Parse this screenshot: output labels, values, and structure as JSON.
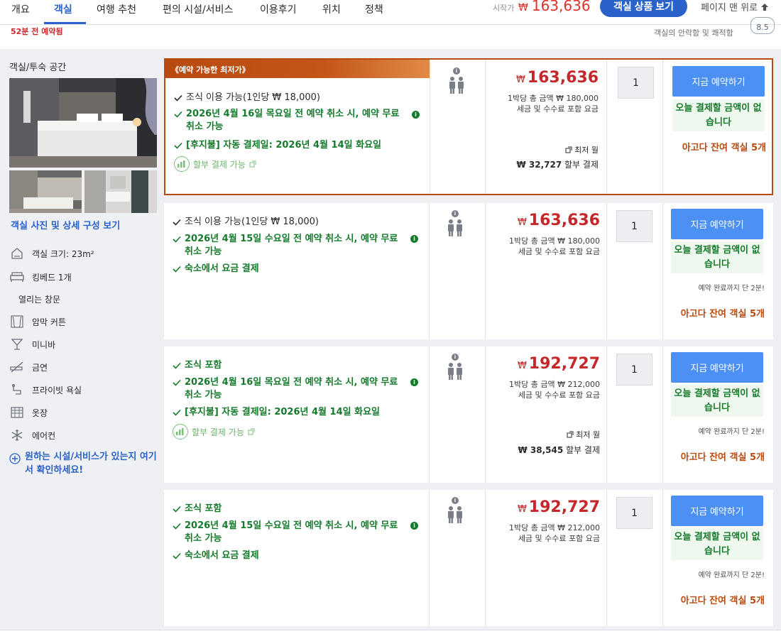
{
  "nav": {
    "tabs": [
      "개요",
      "객실",
      "여행 추천",
      "편의 시설/서비스",
      "이용후기",
      "위치",
      "정책"
    ],
    "start_label": "시작가",
    "currency": "₩",
    "start_price": "163,636",
    "view_rooms_button": "객실 상품 보기",
    "back_to_top": "페이지 맨 위로"
  },
  "substrip": {
    "booked_ago": "52분 전 예약됨",
    "comfort_label": "객실의 안락함 및 쾌적함",
    "score": "8.5"
  },
  "room": {
    "title": "객실/투숙 공간",
    "view_photos": "객실 사진 및 상세 구성 보기",
    "features": [
      {
        "icon": "room-size-icon",
        "label": "객실 크기: 23m²"
      },
      {
        "icon": "bed-icon",
        "label": "킹베드 1개"
      },
      {
        "icon": "",
        "label": "열리는 창문"
      },
      {
        "icon": "curtain-icon",
        "label": "암막 커튼"
      },
      {
        "icon": "minibar-icon",
        "label": "미니바"
      },
      {
        "icon": "no-smoking-icon",
        "label": "금연"
      },
      {
        "icon": "bathroom-icon",
        "label": "프라이빗 욕실"
      },
      {
        "icon": "wardrobe-icon",
        "label": "옷장"
      },
      {
        "icon": "snowflake-icon",
        "label": "에어컨"
      }
    ],
    "facility_link": "원하는 시설/서비스가 있는지 여기서 확인하세요!"
  },
  "offers": [
    {
      "ribbon": "《예약 가능한 최저가》",
      "benefits": [
        {
          "text": "조식 이용 가능(1인당 ₩ 18,000)",
          "style": "plain"
        },
        {
          "text": "2026년 4월 16일 목요일 전 예약 취소 시, 예약 무료 취소 가능",
          "style": "green",
          "info": true
        },
        {
          "text": "[후지불] 자동 결제일: 2026년 4월 14일 화요일",
          "style": "green"
        }
      ],
      "installment": "할부 결제 가능",
      "price": "163,636",
      "price_total": "1박당 총 금액 ₩ 180,000",
      "price_note": "세금 및 수수료 포함 요금",
      "monthly_label": "최저 월",
      "monthly_amount": "₩ 32,727",
      "monthly_suffix": "할부 결제",
      "qty": "1",
      "book_button": "지금 예약하기",
      "pay_today": "오늘 결제할 금액이 없습니다",
      "hurry": "",
      "rooms_left": "아고다 잔여 객실 5개"
    },
    {
      "ribbon": "",
      "benefits": [
        {
          "text": "조식 이용 가능(1인당 ₩ 18,000)",
          "style": "plain"
        },
        {
          "text": "2026년 4월 15일 수요일 전 예약 취소 시, 예약 무료 취소 가능",
          "style": "green",
          "info": true
        },
        {
          "text": "숙소에서 요금 결제",
          "style": "green"
        }
      ],
      "installment": "",
      "price": "163,636",
      "price_total": "1박당 총 금액 ₩ 180,000",
      "price_note": "세금 및 수수료 포함 요금",
      "monthly_label": "",
      "monthly_amount": "",
      "monthly_suffix": "",
      "qty": "1",
      "book_button": "지금 예약하기",
      "pay_today": "오늘 결제할 금액이 없습니다",
      "hurry": "예약 완료까지 단 2분!",
      "rooms_left": "아고다 잔여 객실 5개"
    },
    {
      "ribbon": "",
      "benefits": [
        {
          "text": "조식 포함",
          "style": "green"
        },
        {
          "text": "2026년 4월 16일 목요일 전 예약 취소 시, 예약 무료 취소 가능",
          "style": "green",
          "info": true
        },
        {
          "text": "[후지불] 자동 결제일: 2026년 4월 14일 화요일",
          "style": "green"
        }
      ],
      "installment": "할부 결제 가능",
      "price": "192,727",
      "price_total": "1박당 총 금액 ₩ 212,000",
      "price_note": "세금 및 수수료 포함 요금",
      "monthly_label": "최저 월",
      "monthly_amount": "₩ 38,545",
      "monthly_suffix": "할부 결제",
      "qty": "1",
      "book_button": "지금 예약하기",
      "pay_today": "오늘 결제할 금액이 없습니다",
      "hurry": "예약 완료까지 단 2분!",
      "rooms_left": "아고다 잔여 객실 5개"
    },
    {
      "ribbon": "",
      "benefits": [
        {
          "text": "조식 포함",
          "style": "green"
        },
        {
          "text": "2026년 4월 15일 수요일 전 예약 취소 시, 예약 무료 취소 가능",
          "style": "green",
          "info": true
        },
        {
          "text": "숙소에서 요금 결제",
          "style": "green"
        }
      ],
      "installment": "",
      "price": "192,727",
      "price_total": "1박당 총 금액 ₩ 212,000",
      "price_note": "세금 및 수수료 포함 요금",
      "monthly_label": "",
      "monthly_amount": "",
      "monthly_suffix": "",
      "qty": "1",
      "book_button": "지금 예약하기",
      "pay_today": "오늘 결제할 금액이 없습니다",
      "hurry": "예약 완료까지 단 2분!",
      "rooms_left": "아고다 잔여 객실 5개"
    }
  ]
}
